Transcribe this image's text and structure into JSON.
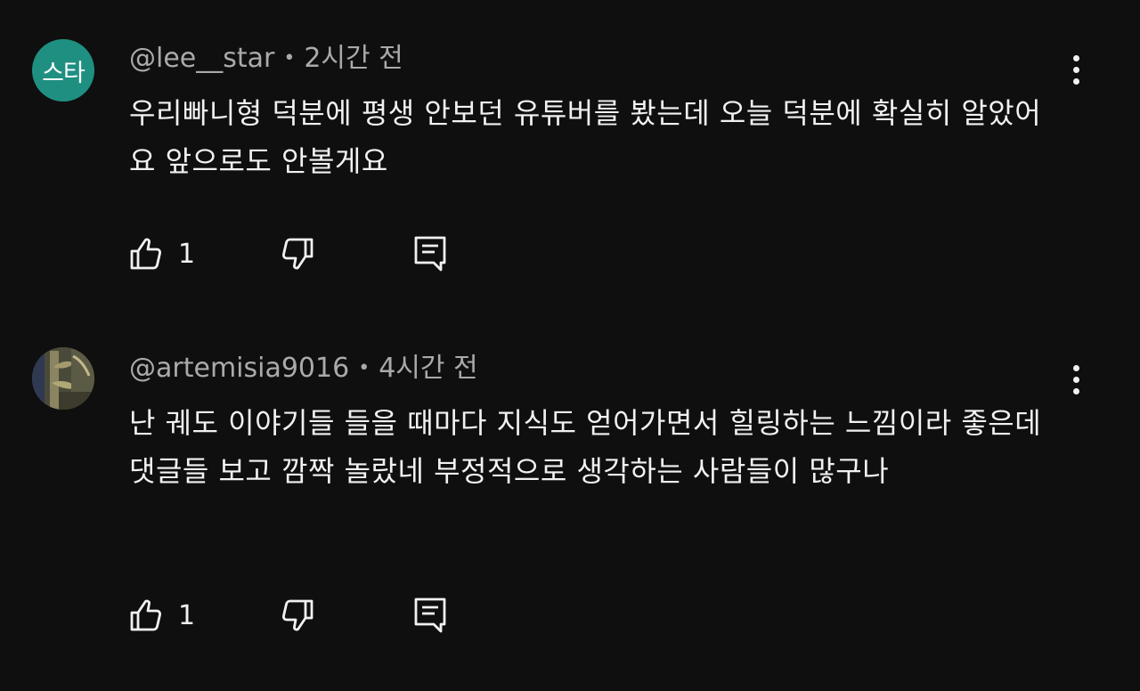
{
  "comments": [
    {
      "avatar_initials": "스타",
      "author": "@lee__star",
      "separator": "•",
      "time": "2시간 전",
      "text": "우리빠니형 덕분에 평생 안보던 유튜버를 봤는데 오늘 덕분에 확실히 알았어요 앞으로도 안볼게요",
      "like_count": "1"
    },
    {
      "author": "@artemisia9016",
      "separator": "•",
      "time": "4시간 전",
      "text": "난 궤도 이야기들 들을 때마다 지식도 얻어가면서 힐링하는 느낌이라 좋은데 댓글들 보고 깜짝 놀랐네 부정적으로 생각하는 사람들이 많구나",
      "like_count": "1"
    }
  ],
  "colors": {
    "background": "#0f0f0f",
    "text_primary": "#f1f1f1",
    "text_secondary": "#aaaaaa",
    "avatar_teal": "#1f8f82"
  },
  "icons": [
    "thumbs-up-icon",
    "thumbs-down-icon",
    "reply-icon",
    "more-vert-icon"
  ]
}
